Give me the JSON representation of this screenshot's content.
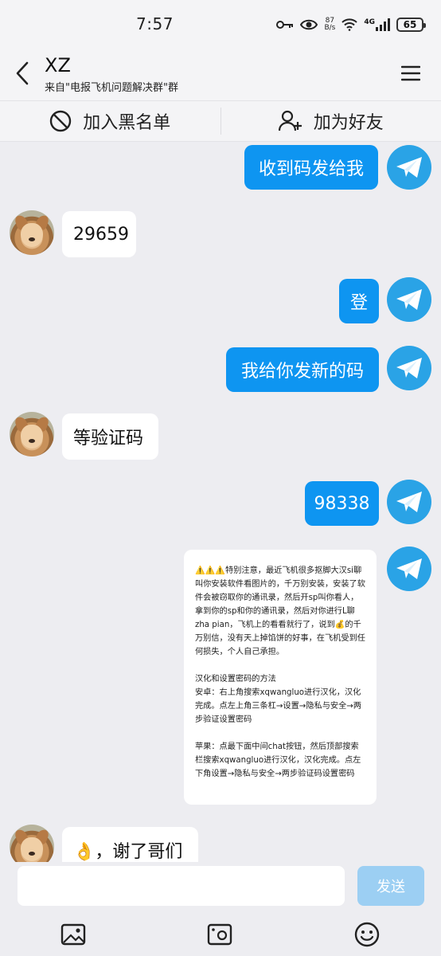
{
  "status_bar": {
    "time": "7:57",
    "net_speed_value": "87",
    "net_speed_unit": "B/s",
    "network": "4G",
    "battery": "65"
  },
  "header": {
    "title": "XZ",
    "subtitle": "来自\"电报飞机问题解决群\"群"
  },
  "actions": {
    "block": "加入黑名单",
    "add_friend": "加为好友"
  },
  "messages": [
    {
      "side": "out",
      "text": "收到码发给我"
    },
    {
      "side": "in",
      "text": "29659"
    },
    {
      "side": "out",
      "text": "登"
    },
    {
      "side": "out",
      "text": "我给你发新的码"
    },
    {
      "side": "in",
      "text": "等验证码"
    },
    {
      "side": "out",
      "text": "98338"
    },
    {
      "side": "out",
      "type": "card",
      "p1": "⚠️⚠️⚠️特别注意，最近飞机很多抠脚大汉si聊叫你安装软件看图片的，千万别安装，安装了软件会被窃取你的通讯录，然后开sp叫你看人，拿到你的sp和你的通讯录，然后对你进行L聊zha pian，飞机上的看看就行了，说到💰的千万别信，没有天上掉馅饼的好事，在飞机受到任何损失，个人自己承担。",
      "p2": "汉化和设置密码的方法\n安卓：右上角搜索xqwangluo进行汉化，汉化完成。点左上角三条杠→设置→隐私与安全→两步验证设置密码",
      "p3": "苹果：点最下面中间chat按钮，然后顶部搜索栏搜索xqwangluo进行汉化，汉化完成。点左下角设置→隐私与安全→两步验证码设置密码"
    },
    {
      "side": "in",
      "text": "👌，谢了哥们"
    }
  ],
  "composer": {
    "input_value": "",
    "send_label": "发送"
  },
  "toolbar_icons": [
    "image-icon",
    "sticker-icon",
    "emoji-icon"
  ],
  "colors": {
    "outgoing_bubble": "#0e95f1",
    "telegram_avatar": "#2aa3e6",
    "send_disabled": "#9ccff3",
    "background": "#ededf1"
  }
}
